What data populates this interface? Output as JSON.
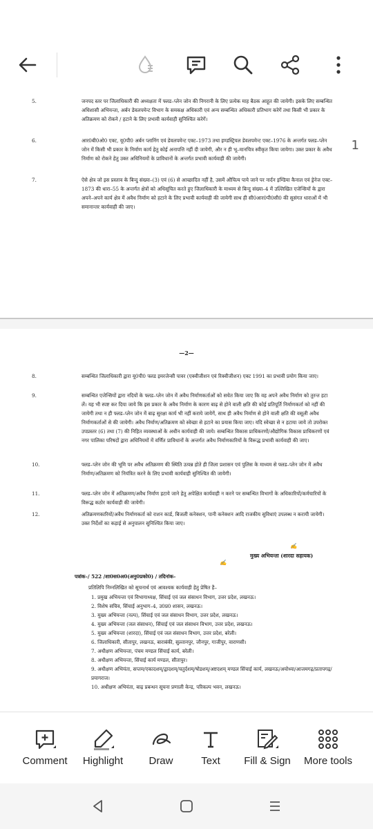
{
  "toolbar": {
    "back_icon": "arrow-left-icon",
    "readmode_icon": "liquid-mode-icon",
    "comments_icon": "comment-list-icon",
    "search_icon": "search-icon",
    "share_icon": "share-icon",
    "more_icon": "more-vertical-icon"
  },
  "page_indicator": "1",
  "page1": {
    "items": [
      {
        "num": "5.",
        "text": "जनपद स्तर पर जिलाधिकारी की अध्यक्षता में फ्लड–प्लेन जोन की निगरानी के लिए प्रत्येक माह बैठक आहूत की जायेगी। इसके लिए सम्बन्धित अधिशासी अभियन्ता, अर्बन डेवलपमेन्ट विभाग के समकक्ष अधिकारी एवं अन्य सम्बन्धित अधिकारी प्रतिभाग करेगें तथा किसी भी प्रकार के अतिक्रमण को रोकने / हटाने के लिए प्रभावी कार्यवाही सुनिश्चित करेगें।"
      },
      {
        "num": "6.",
        "text": "आर0बी0ओ0 एक्ट, यू0पी0 अर्बन प्लानिंग एवं डेवलपमेन्ट एक्ट–1973 तथा इण्डस्ट्रियल डेवलपमेन्ट एक्ट–1976 के अन्तर्गत फ्लड–प्लेन जोन में किसी भी प्रकार के निर्माण कार्य हेतु कोई अनापत्ति नहीं दी जायेगी, और न ही भू–मानचित्र स्वीकृत किया जायेगा। उक्त प्रकार के अवैध निर्माण को रोकने हेतु उक्त अधिनियमों के प्राविधानों के अन्तर्गत प्रभावी कार्यवाही की जायेगी।"
      },
      {
        "num": "7.",
        "text": "ऐसे क्षेत्र जो इस प्रस्ताव के बिन्दु संख्या–(3) एवं (6) से आच्छादित नहीं है, उसमें औचित्य पाये जाने पर नार्दन इण्डिया कैनाल एवं ड्रेनेज एक्ट–1873 की धारा–55 के अन्तर्गत क्षेत्रों को अधिसूचित करते हुए जिलाधिकारी के माध्यम से बिन्दु संख्या–4 में उल्लिखित एजेन्सियों के द्वारा अपने–अपने कार्य क्षेत्र में अवैध निर्माण को हटाने के लिए प्रभावी कार्यवाही की जायेगी साथ ही सी0आर0पी0सी0 की सुसंगत धाराओं में भी समानान्तर कार्यवाही की जाए।"
      }
    ]
  },
  "page2": {
    "page_number": "—2—",
    "items": [
      {
        "num": "8.",
        "text": "सम्बन्धित जिलाधिकारी द्वारा यू0पी0 फ्लड इमरजेन्सी पावर (एक्वीजीशन एवं रिक्वीजीशन) एक्ट 1991 का प्रभावी प्रयोग किया जाए।"
      },
      {
        "num": "9.",
        "text": "सम्बन्धित एजेन्सियों द्वारा नदियों के फ्लड–प्लेन जोन में अवैध निर्माणकर्ताओं को सचेत किया जाए कि वह अपने अवैध निर्माण को तुरन्त हटा लें। यह भी स्पष्ट कर दिया जाये कि इस प्रकार के अवैध निर्माण के कारण बाढ़ से होने वाली क्षति की कोई प्रतिपूर्ति निर्माणकर्ता को नहीं की जायेगी तथा न ही फ्लड–प्लेन जोन में बाढ़ सुरक्षा कार्य भी नहीं कराये जायेगें, साथ ही अवैध निर्माण से होने वाली क्षति की वसूली अवैध निर्माणकर्ताओं से की जायेगी। अवैध निर्माण/अतिक्रमण को स्वेच्छा से हटाने का प्रयास किया जाए। यदि स्वेच्छा से न हटाया जाये तो उपरोक्त उपप्रस्तर (6) तथा (7) की निहित व्यवस्थाओं के अधीन कार्यवाही की जाये। सम्बन्धित विकास प्राधिकरणों/औद्योगिक विकास प्राधिकरणों एवं नगर पालिका परिषदों द्वारा अधिनियमों में वर्णित प्राविधानों के अन्तर्गत अवैध निर्माणकारियों के विरूद्ध प्रभावी कार्यवाही की जाए।"
      },
      {
        "num": "10.",
        "text": "फ्लड–प्लेन जोन की भूमि पर अवैध अतिक्रमण की स्थिति उत्पन्न होते ही जिला प्रशासन एवं पुलिस के माध्यम से फ्लड–प्लेन जोन में अवैध निर्माण/अतिक्रमण को नियंत्रित करने के लिए प्रभावी कार्यवाही सुनिश्चित की जायेगी।"
      },
      {
        "num": "11.",
        "text": "फ्लड–प्लेन जोन में अतिक्रमण/अवैध निर्माण हटाये जाने हेतु अपेक्षित कार्यवाही न करने पर सम्बन्धित विभागों के अधिकारियों/कर्मचारियों के विरूद्ध कठोर कार्यवाही की जायेगी।"
      },
      {
        "num": "12.",
        "text": "अतिक्रमणकारियों/अवैध निर्माणकर्ता को राशन कार्ड, बिजली कनेक्शन, पानी कनेक्शन आदि राजकीय सुविधाएं उपलब्ध न करायी जायेगी। उक्त निर्देशों का कड़ाई से अनुपालन सुनिश्चित किया जाए।"
      }
    ],
    "signature": "मुख्य अभियन्ता (शारदा सहायक)",
    "ref": "पत्रांक–/ 522 /शा0स0अ0(अनु0प्रको0) / तदिनांक–",
    "copy_intro": "प्रतिलिपि निम्नलिखित को सूचनार्थ एवं आवश्यक कार्यवाही हेतु प्रेषित है–",
    "copies": [
      "1. प्रमुख अभियन्ता एवं विभागाध्यक्ष, सिंचाई एवं जल संसाधन विभाग, उत्तर प्रदेश, लखनऊ।",
      "2. विशेष सचिव, सिंचाई अनुभाग–4, उ0प्र0 शासन, लखनऊ।",
      "3. मुख्य अभियन्ता (नल्प), सिंचाई एवं जल संसाधन विभाग, उत्तर प्रदेश, लखनऊ।",
      "4. मुख्य अभियन्ता (जल संसाधन), सिंचाई एवं जल संसाधन विभाग, उत्तर प्रदेश, लखनऊ।",
      "5. मुख्य अभियन्ता (शारदा), सिंचाई एवं जल संसाधन विभाग, उत्तर प्रदेश, बरेली।",
      "6. जिलाधिकारी, सीतापुर, लखनऊ, बाराबंकी, सुल्तानपुर, जौनपुर, गाजीपुर, वाराणसी।",
      "7. अधीक्षण अभियन्ता, पंचम मण्डल सिंचाई कार्य, बरेली।",
      "8. अधीक्षण अभियन्ता, सिंचाई कार्य मण्डल, सीतापुर।",
      "9. अधीक्षण अभियंता, सप्तम/एकादशम्/द्वादशम्/चतुर्दशम्/षोडशम्/अष्टदशम् मण्डल सिंचाई कार्य, लखनऊ/अयोध्या/आजमगढ़/प्रतापगढ़/प्रयागराज।",
      "10. अधीक्षण अभियंता, बाढ़ प्रबन्धन सूचना प्रणाली केन्द्र, परिकल्प भवन, लखनऊ।"
    ]
  },
  "bottom_tools": [
    {
      "label": "Comment",
      "icon": "comment-plus-icon"
    },
    {
      "label": "Highlight",
      "icon": "highlighter-icon"
    },
    {
      "label": "Draw",
      "icon": "draw-icon"
    },
    {
      "label": "Text",
      "icon": "text-icon"
    },
    {
      "label": "Fill & Sign",
      "icon": "fill-sign-icon"
    },
    {
      "label": "More tools",
      "icon": "grid-dots-icon"
    }
  ],
  "nav": {
    "back_icon": "nav-back-icon",
    "home_icon": "nav-home-icon",
    "recents_icon": "nav-recents-icon"
  }
}
